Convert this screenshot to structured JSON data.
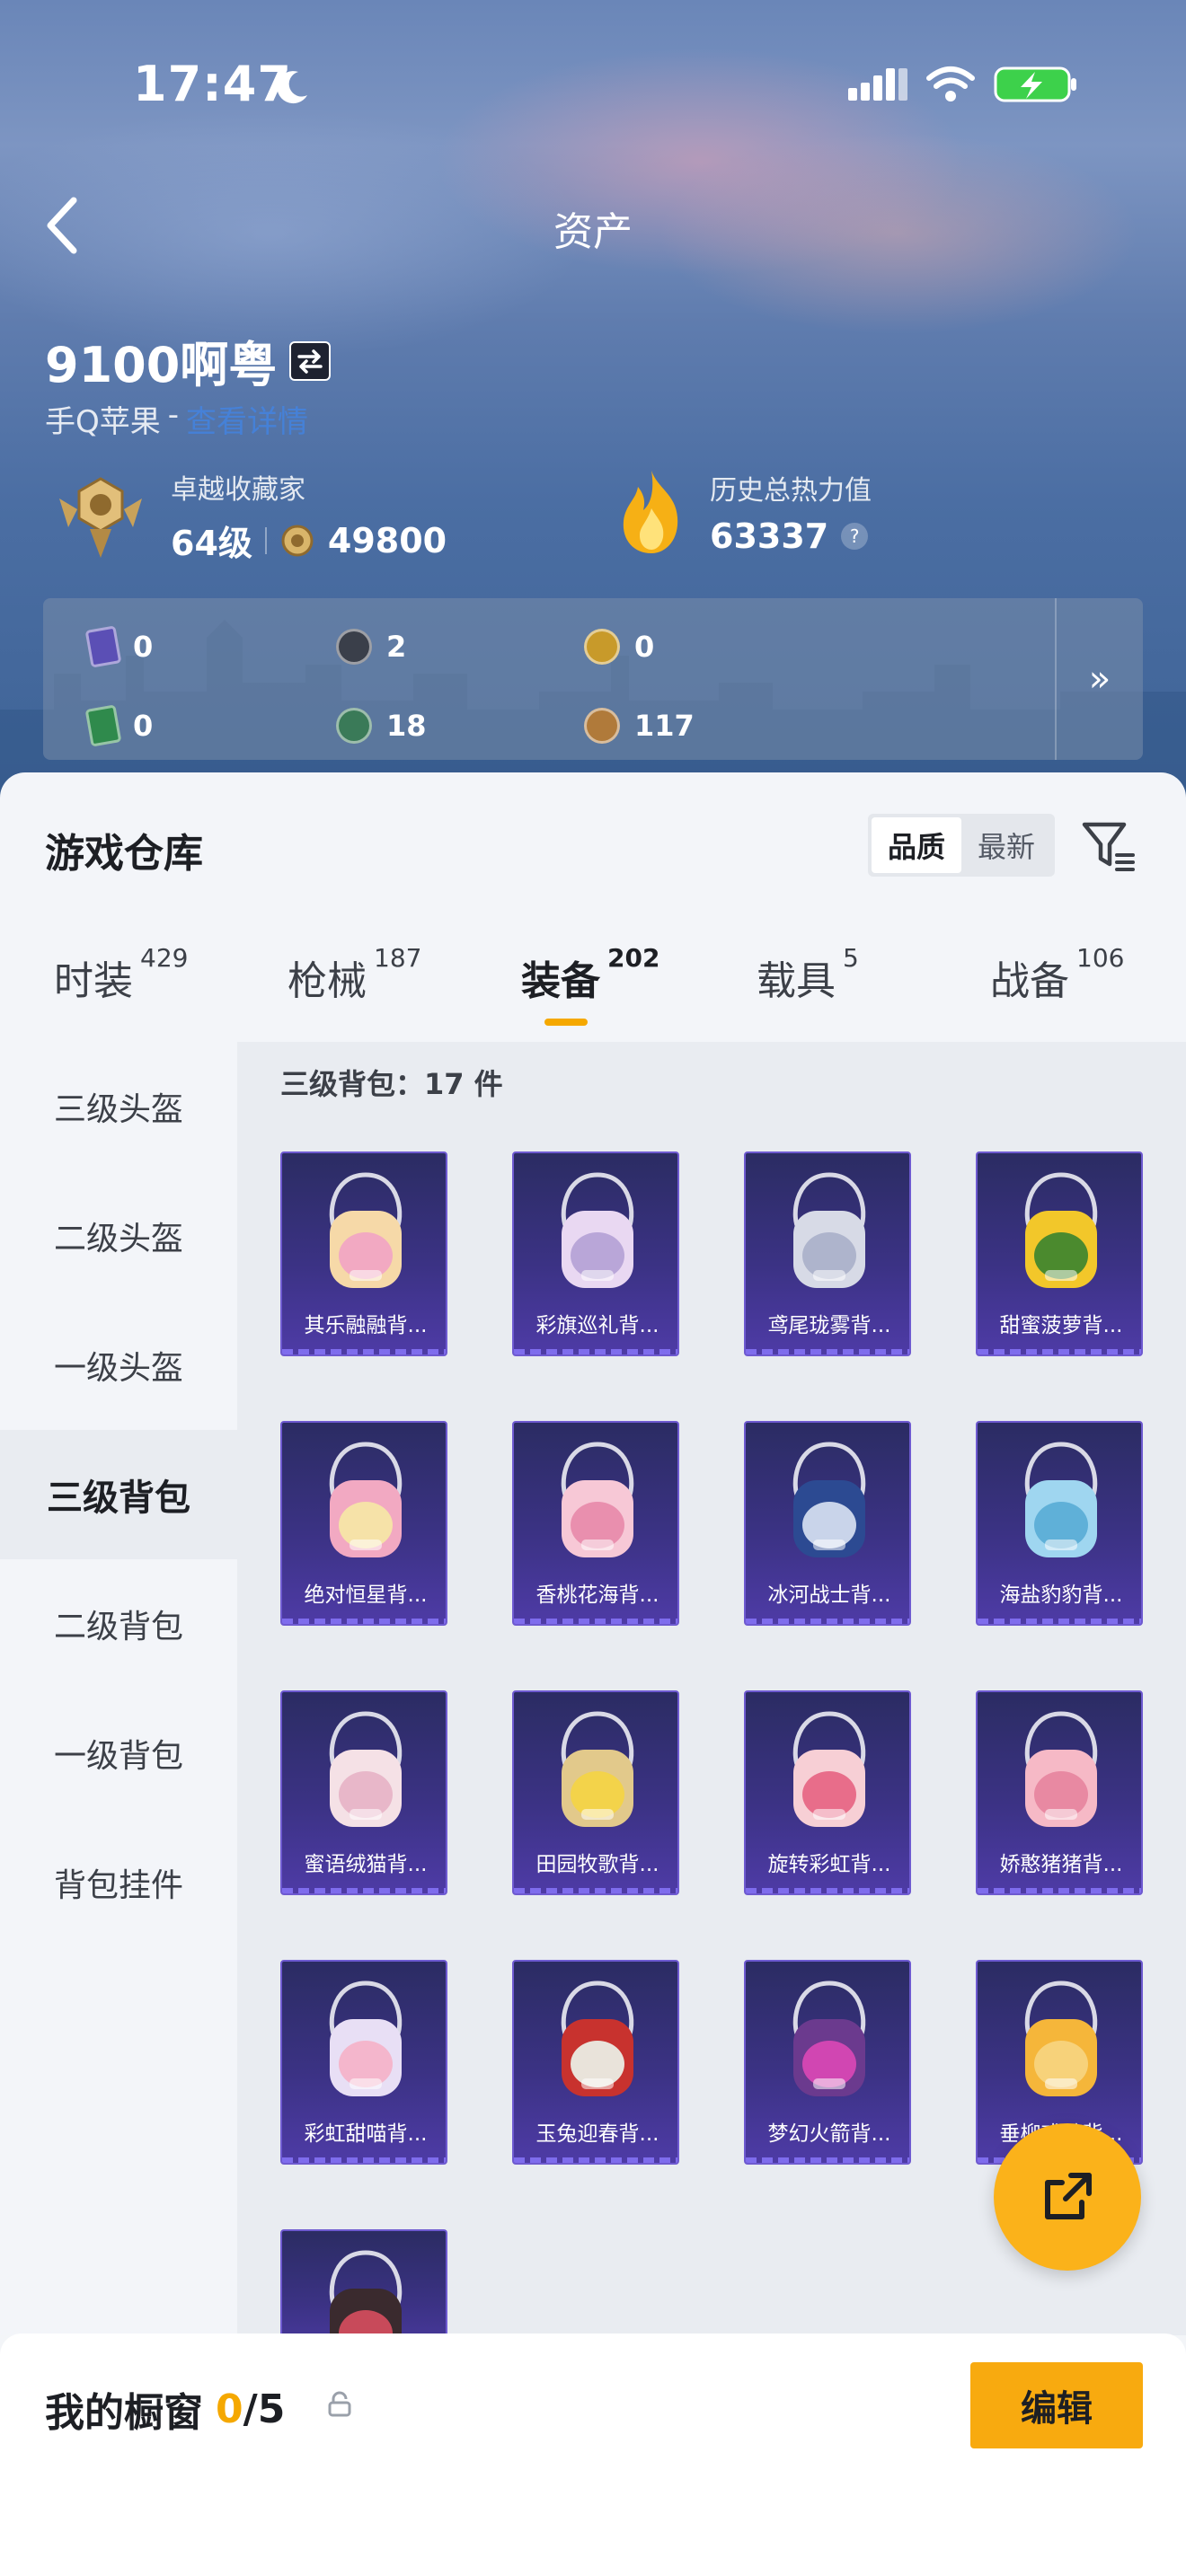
{
  "status_bar": {
    "time": "17:47"
  },
  "header": {
    "title": "资产"
  },
  "profile": {
    "name": "9100啊粤",
    "platform": "手Q苹果",
    "separator": "-",
    "link_text": "查看详情",
    "collector_label": "卓越收藏家",
    "level": "64级",
    "collector_points": "49800",
    "heat_label": "历史总热力值",
    "heat_value": "63337",
    "heat_help": "?"
  },
  "currencies": [
    {
      "icon": "purple-card-icon",
      "value": "0",
      "color": "#5b4fb5"
    },
    {
      "icon": "dark-coin-icon",
      "value": "2",
      "color": "#3a3f4a"
    },
    {
      "icon": "gold-coin-icon",
      "value": "0",
      "color": "#c89a2a"
    },
    {
      "icon": "green-card-icon",
      "value": "0",
      "color": "#2f8a4c"
    },
    {
      "icon": "green-orb-icon",
      "value": "18",
      "color": "#3a7a58"
    },
    {
      "icon": "bronze-coin-icon",
      "value": "117",
      "color": "#b07a3a"
    }
  ],
  "currency_more": "»",
  "warehouse": {
    "title": "游戏仓库",
    "sort_options": [
      "品质",
      "最新"
    ],
    "tabs": [
      {
        "label": "时装",
        "count": "429"
      },
      {
        "label": "枪械",
        "count": "187"
      },
      {
        "label": "装备",
        "count": "202"
      },
      {
        "label": "载具",
        "count": "5"
      },
      {
        "label": "战备",
        "count": "106"
      }
    ],
    "side_nav": [
      "三级头盔",
      "二级头盔",
      "一级头盔",
      "三级背包",
      "二级背包",
      "一级背包",
      "背包挂件"
    ],
    "section_header": "三级背包：17 件",
    "items": [
      {
        "name": "其乐融融背...",
        "art": "cake-backpack"
      },
      {
        "name": "彩旗巡礼背...",
        "art": "bow-backpack"
      },
      {
        "name": "鸢尾珑雾背...",
        "art": "silver-backpack"
      },
      {
        "name": "甜蜜菠萝背...",
        "art": "pineapple-backpack"
      },
      {
        "name": "绝对恒星背...",
        "art": "popcorn-backpack"
      },
      {
        "name": "香桃花海背...",
        "art": "peach-backpack"
      },
      {
        "name": "冰河战士背...",
        "art": "armor-backpack"
      },
      {
        "name": "海盐豹豹背...",
        "art": "seal-backpack"
      },
      {
        "name": "蜜语绒猫背...",
        "art": "cat-backpack"
      },
      {
        "name": "田园牧歌背...",
        "art": "basket-backpack"
      },
      {
        "name": "旋转彩虹背...",
        "art": "carousel-backpack"
      },
      {
        "name": "娇憨猪猪背...",
        "art": "pig-backpack"
      },
      {
        "name": "彩虹甜喵背...",
        "art": "unicorn-cat-backpack"
      },
      {
        "name": "玉兔迎春背...",
        "art": "rabbit-backpack"
      },
      {
        "name": "梦幻火箭背...",
        "art": "rocket-backpack"
      },
      {
        "name": "垂柳戏鸭背...",
        "art": "duck-backpack"
      },
      {
        "name": "",
        "art": "pillow-backpack"
      }
    ]
  },
  "showcase": {
    "label": "我的橱窗",
    "current": "0",
    "total": "/5"
  },
  "edit_button": "编辑",
  "colors": {
    "accent": "#f5a800",
    "card_top": "#2b2c63",
    "card_bottom": "#4e3ba6"
  }
}
